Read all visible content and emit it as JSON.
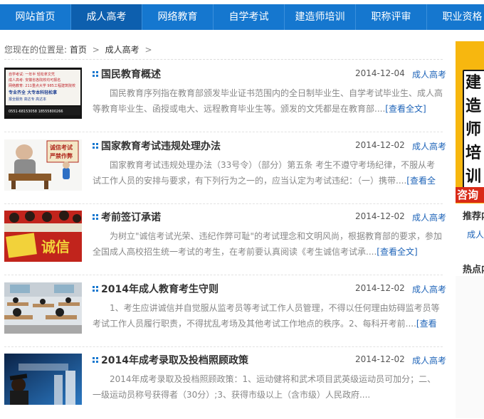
{
  "nav": {
    "items": [
      {
        "label": "网站首页",
        "active": false
      },
      {
        "label": "成人高考",
        "active": true
      },
      {
        "label": "网络教育",
        "active": false
      },
      {
        "label": "自学考试",
        "active": false
      },
      {
        "label": "建造师培训",
        "active": false
      },
      {
        "label": "职称评审",
        "active": false
      },
      {
        "label": "职业资格",
        "active": false
      }
    ]
  },
  "breadcrumb": {
    "prefix": "您现在的位置是:",
    "home": "首页",
    "sep1": ">",
    "current": "成人高考",
    "sep2": ">"
  },
  "articles": [
    {
      "title": "国民教育概述",
      "date": "2014-12-04",
      "category": "成人高考",
      "summary": "国民教育序列指在教育部颁发毕业证书范围内的全日制毕业生、自学考试毕业生、成人高等教育毕业生、函授或电大、远程教育毕业生等。颁发的文凭都是在教育部....",
      "more": "[查看全文]",
      "thumb": {
        "lines": [
          "自学考试: 一年半 轻松拿文凭",
          "成人高考: 安徽省各院校均可报名",
          "网络教育: 211重点大学 985工程建筑院校",
          "专业齐全 大专本科轻松拿",
          "报全服务 高达专  高达本",
          "0551-68153058  18555800266"
        ]
      }
    },
    {
      "title": "国家教育考试违规处理办法",
      "date": "2014-12-02",
      "category": "成人高考",
      "summary": "国家教育考试违规处理办法（33号令）（部分）第五条 考生不遵守考场纪律，不服从考试工作人员的安排与要求，有下列行为之一的，应当认定为考试违纪：（一）携带....",
      "more": "[查看全文]",
      "thumb": {
        "lines": [
          "诚信考试",
          "严禁作弊"
        ]
      }
    },
    {
      "title": "考前签订承诺",
      "date": "2014-12-02",
      "category": "成人高考",
      "summary": "为树立\"诚信考试光荣、违纪作弊可耻\"的考试理念和文明风尚，根据教育部的要求，参加全国成人高校招生统一考试的考生，在考前要认真阅读《考生诚信考试承....",
      "more": "[查看全文]",
      "thumb": {
        "lines": [
          "诚信"
        ]
      }
    },
    {
      "title": "2014年成人教育考生守则",
      "date": "2014-12-02",
      "category": "成人高考",
      "summary": "1、考生应讲诚信并自觉服从监考员等考试工作人员管理，不得以任何理由妨碍监考员等考试工作人员履行职责，不得扰乱考场及其他考试工作地点的秩序。2、每科开考前....",
      "more": "[查看全文]",
      "thumb": {
        "lines": []
      }
    },
    {
      "title": "2014年成考录取及投档照顾政策",
      "date": "2014-12-02",
      "category": "成人高考",
      "summary": "2014年成考录取及投档照顾政策：1、运动健将和武术项目武英级运动员可加分；二、一级运动员称号获得者（30分）;3、获得市级以上（含市级）人民政府....",
      "more": "",
      "thumb": {
        "lines": []
      }
    }
  ],
  "sidebar": {
    "banner_text": "建造师培训",
    "ask": "咨询",
    "heading1": "推荐内容",
    "link1": "成人高考",
    "heading2": "热点内容"
  }
}
